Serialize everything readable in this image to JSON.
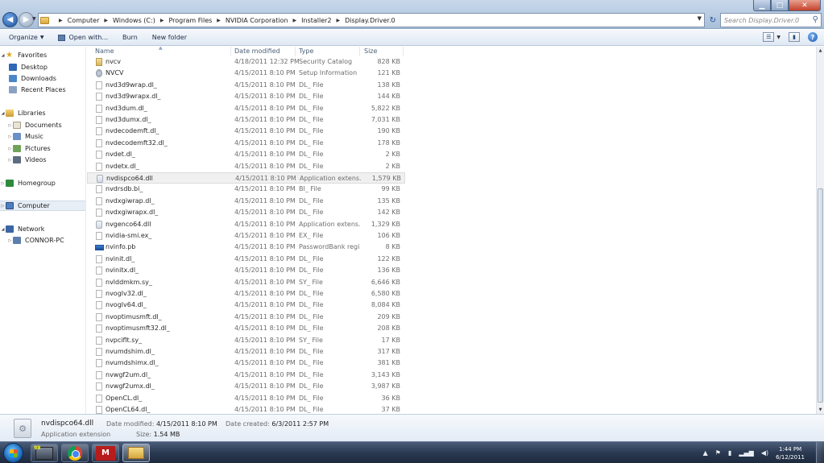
{
  "address": {
    "crumbs": [
      "Computer",
      "Windows (C:)",
      "Program Files",
      "NVIDIA Corporation",
      "Installer2",
      "Display.Driver.0"
    ],
    "search_placeholder": "Search Display.Driver.0"
  },
  "toolbar": {
    "organize": "Organize",
    "open_with": "Open with...",
    "burn": "Burn",
    "new_folder": "New folder"
  },
  "nav": {
    "favorites": "Favorites",
    "desktop": "Desktop",
    "downloads": "Downloads",
    "recent": "Recent Places",
    "libraries": "Libraries",
    "documents": "Documents",
    "music": "Music",
    "pictures": "Pictures",
    "videos": "Videos",
    "homegroup": "Homegroup",
    "computer": "Computer",
    "network": "Network",
    "connor_pc": "CONNOR-PC"
  },
  "columns": {
    "name": "Name",
    "date": "Date modified",
    "type": "Type",
    "size": "Size"
  },
  "files": [
    {
      "name": "nvcv",
      "date": "4/18/2011 12:32 PM",
      "type": "Security Catalog",
      "size": "828 KB",
      "icon": "catalog-icon"
    },
    {
      "name": "NVCV",
      "date": "4/15/2011 8:10 PM",
      "type": "Setup Information",
      "size": "121 KB",
      "icon": "setup-info-icon"
    },
    {
      "name": "nvd3d9wrap.dl_",
      "date": "4/15/2011 8:10 PM",
      "type": "DL_ File",
      "size": "138 KB",
      "icon": "file-icon"
    },
    {
      "name": "nvd3d9wrapx.dl_",
      "date": "4/15/2011 8:10 PM",
      "type": "DL_ File",
      "size": "144 KB",
      "icon": "file-icon"
    },
    {
      "name": "nvd3dum.dl_",
      "date": "4/15/2011 8:10 PM",
      "type": "DL_ File",
      "size": "5,822 KB",
      "icon": "file-icon"
    },
    {
      "name": "nvd3dumx.dl_",
      "date": "4/15/2011 8:10 PM",
      "type": "DL_ File",
      "size": "7,031 KB",
      "icon": "file-icon"
    },
    {
      "name": "nvdecodemft.dl_",
      "date": "4/15/2011 8:10 PM",
      "type": "DL_ File",
      "size": "190 KB",
      "icon": "file-icon"
    },
    {
      "name": "nvdecodemft32.dl_",
      "date": "4/15/2011 8:10 PM",
      "type": "DL_ File",
      "size": "178 KB",
      "icon": "file-icon"
    },
    {
      "name": "nvdet.dl_",
      "date": "4/15/2011 8:10 PM",
      "type": "DL_ File",
      "size": "2 KB",
      "icon": "file-icon"
    },
    {
      "name": "nvdetx.dl_",
      "date": "4/15/2011 8:10 PM",
      "type": "DL_ File",
      "size": "2 KB",
      "icon": "file-icon"
    },
    {
      "name": "nvdispco64.dll",
      "date": "4/15/2011 8:10 PM",
      "type": "Application extens...",
      "size": "1,579 KB",
      "icon": "app-extension-icon",
      "selected": true
    },
    {
      "name": "nvdrsdb.bi_",
      "date": "4/15/2011 8:10 PM",
      "type": "BI_ File",
      "size": "99 KB",
      "icon": "file-icon"
    },
    {
      "name": "nvdxgiwrap.dl_",
      "date": "4/15/2011 8:10 PM",
      "type": "DL_ File",
      "size": "135 KB",
      "icon": "file-icon"
    },
    {
      "name": "nvdxgiwrapx.dl_",
      "date": "4/15/2011 8:10 PM",
      "type": "DL_ File",
      "size": "142 KB",
      "icon": "file-icon"
    },
    {
      "name": "nvgenco64.dll",
      "date": "4/15/2011 8:10 PM",
      "type": "Application extens...",
      "size": "1,329 KB",
      "icon": "app-extension-icon"
    },
    {
      "name": "nvidia-smi.ex_",
      "date": "4/15/2011 8:10 PM",
      "type": "EX_ File",
      "size": "106 KB",
      "icon": "file-icon"
    },
    {
      "name": "nvinfo.pb",
      "date": "4/15/2011 8:10 PM",
      "type": "PasswordBank regi...",
      "size": "8 KB",
      "icon": "passwordbank-icon"
    },
    {
      "name": "nvinit.dl_",
      "date": "4/15/2011 8:10 PM",
      "type": "DL_ File",
      "size": "122 KB",
      "icon": "file-icon"
    },
    {
      "name": "nvinitx.dl_",
      "date": "4/15/2011 8:10 PM",
      "type": "DL_ File",
      "size": "136 KB",
      "icon": "file-icon"
    },
    {
      "name": "nvlddmkm.sy_",
      "date": "4/15/2011 8:10 PM",
      "type": "SY_ File",
      "size": "6,646 KB",
      "icon": "file-icon"
    },
    {
      "name": "nvoglv32.dl_",
      "date": "4/15/2011 8:10 PM",
      "type": "DL_ File",
      "size": "6,580 KB",
      "icon": "file-icon"
    },
    {
      "name": "nvoglv64.dl_",
      "date": "4/15/2011 8:10 PM",
      "type": "DL_ File",
      "size": "8,084 KB",
      "icon": "file-icon"
    },
    {
      "name": "nvoptimusmft.dl_",
      "date": "4/15/2011 8:10 PM",
      "type": "DL_ File",
      "size": "209 KB",
      "icon": "file-icon"
    },
    {
      "name": "nvoptimusmft32.dl_",
      "date": "4/15/2011 8:10 PM",
      "type": "DL_ File",
      "size": "208 KB",
      "icon": "file-icon"
    },
    {
      "name": "nvpciflt.sy_",
      "date": "4/15/2011 8:10 PM",
      "type": "SY_ File",
      "size": "17 KB",
      "icon": "file-icon"
    },
    {
      "name": "nvumdshim.dl_",
      "date": "4/15/2011 8:10 PM",
      "type": "DL_ File",
      "size": "317 KB",
      "icon": "file-icon"
    },
    {
      "name": "nvumdshimx.dl_",
      "date": "4/15/2011 8:10 PM",
      "type": "DL_ File",
      "size": "381 KB",
      "icon": "file-icon"
    },
    {
      "name": "nvwgf2um.dl_",
      "date": "4/15/2011 8:10 PM",
      "type": "DL_ File",
      "size": "3,143 KB",
      "icon": "file-icon"
    },
    {
      "name": "nvwgf2umx.dl_",
      "date": "4/15/2011 8:10 PM",
      "type": "DL_ File",
      "size": "3,987 KB",
      "icon": "file-icon"
    },
    {
      "name": "OpenCL.dl_",
      "date": "4/15/2011 8:10 PM",
      "type": "DL_ File",
      "size": "36 KB",
      "icon": "file-icon"
    },
    {
      "name": "OpenCL64.dl_",
      "date": "4/15/2011 8:10 PM",
      "type": "DL_ File",
      "size": "37 KB",
      "icon": "file-icon"
    }
  ],
  "details": {
    "name": "nvdispco64.dll",
    "type": "Application extension",
    "date_modified_label": "Date modified:",
    "date_modified": "4/15/2011 8:10 PM",
    "date_created_label": "Date created:",
    "date_created": "6/3/2011 2:57 PM",
    "size_label": "Size:",
    "size": "1.54 MB"
  },
  "taskbar": {
    "media_badge": "99",
    "app_letter": "M",
    "time": "1:44 PM",
    "date": "6/12/2011"
  },
  "colors": {
    "accent": "#3a6ea5",
    "selection": "#f0f0f0"
  }
}
